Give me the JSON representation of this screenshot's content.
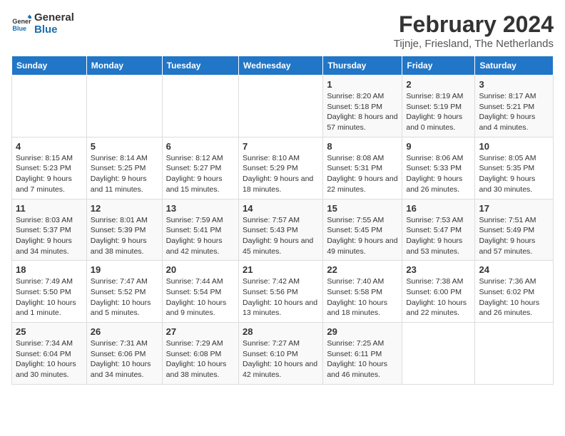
{
  "logo": {
    "text_general": "General",
    "text_blue": "Blue"
  },
  "header": {
    "title": "February 2024",
    "subtitle": "Tijnje, Friesland, The Netherlands"
  },
  "weekdays": [
    "Sunday",
    "Monday",
    "Tuesday",
    "Wednesday",
    "Thursday",
    "Friday",
    "Saturday"
  ],
  "weeks": [
    [
      {
        "day": "",
        "info": ""
      },
      {
        "day": "",
        "info": ""
      },
      {
        "day": "",
        "info": ""
      },
      {
        "day": "",
        "info": ""
      },
      {
        "day": "1",
        "info": "Sunrise: 8:20 AM\nSunset: 5:18 PM\nDaylight: 8 hours and 57 minutes."
      },
      {
        "day": "2",
        "info": "Sunrise: 8:19 AM\nSunset: 5:19 PM\nDaylight: 9 hours and 0 minutes."
      },
      {
        "day": "3",
        "info": "Sunrise: 8:17 AM\nSunset: 5:21 PM\nDaylight: 9 hours and 4 minutes."
      }
    ],
    [
      {
        "day": "4",
        "info": "Sunrise: 8:15 AM\nSunset: 5:23 PM\nDaylight: 9 hours and 7 minutes."
      },
      {
        "day": "5",
        "info": "Sunrise: 8:14 AM\nSunset: 5:25 PM\nDaylight: 9 hours and 11 minutes."
      },
      {
        "day": "6",
        "info": "Sunrise: 8:12 AM\nSunset: 5:27 PM\nDaylight: 9 hours and 15 minutes."
      },
      {
        "day": "7",
        "info": "Sunrise: 8:10 AM\nSunset: 5:29 PM\nDaylight: 9 hours and 18 minutes."
      },
      {
        "day": "8",
        "info": "Sunrise: 8:08 AM\nSunset: 5:31 PM\nDaylight: 9 hours and 22 minutes."
      },
      {
        "day": "9",
        "info": "Sunrise: 8:06 AM\nSunset: 5:33 PM\nDaylight: 9 hours and 26 minutes."
      },
      {
        "day": "10",
        "info": "Sunrise: 8:05 AM\nSunset: 5:35 PM\nDaylight: 9 hours and 30 minutes."
      }
    ],
    [
      {
        "day": "11",
        "info": "Sunrise: 8:03 AM\nSunset: 5:37 PM\nDaylight: 9 hours and 34 minutes."
      },
      {
        "day": "12",
        "info": "Sunrise: 8:01 AM\nSunset: 5:39 PM\nDaylight: 9 hours and 38 minutes."
      },
      {
        "day": "13",
        "info": "Sunrise: 7:59 AM\nSunset: 5:41 PM\nDaylight: 9 hours and 42 minutes."
      },
      {
        "day": "14",
        "info": "Sunrise: 7:57 AM\nSunset: 5:43 PM\nDaylight: 9 hours and 45 minutes."
      },
      {
        "day": "15",
        "info": "Sunrise: 7:55 AM\nSunset: 5:45 PM\nDaylight: 9 hours and 49 minutes."
      },
      {
        "day": "16",
        "info": "Sunrise: 7:53 AM\nSunset: 5:47 PM\nDaylight: 9 hours and 53 minutes."
      },
      {
        "day": "17",
        "info": "Sunrise: 7:51 AM\nSunset: 5:49 PM\nDaylight: 9 hours and 57 minutes."
      }
    ],
    [
      {
        "day": "18",
        "info": "Sunrise: 7:49 AM\nSunset: 5:50 PM\nDaylight: 10 hours and 1 minute."
      },
      {
        "day": "19",
        "info": "Sunrise: 7:47 AM\nSunset: 5:52 PM\nDaylight: 10 hours and 5 minutes."
      },
      {
        "day": "20",
        "info": "Sunrise: 7:44 AM\nSunset: 5:54 PM\nDaylight: 10 hours and 9 minutes."
      },
      {
        "day": "21",
        "info": "Sunrise: 7:42 AM\nSunset: 5:56 PM\nDaylight: 10 hours and 13 minutes."
      },
      {
        "day": "22",
        "info": "Sunrise: 7:40 AM\nSunset: 5:58 PM\nDaylight: 10 hours and 18 minutes."
      },
      {
        "day": "23",
        "info": "Sunrise: 7:38 AM\nSunset: 6:00 PM\nDaylight: 10 hours and 22 minutes."
      },
      {
        "day": "24",
        "info": "Sunrise: 7:36 AM\nSunset: 6:02 PM\nDaylight: 10 hours and 26 minutes."
      }
    ],
    [
      {
        "day": "25",
        "info": "Sunrise: 7:34 AM\nSunset: 6:04 PM\nDaylight: 10 hours and 30 minutes."
      },
      {
        "day": "26",
        "info": "Sunrise: 7:31 AM\nSunset: 6:06 PM\nDaylight: 10 hours and 34 minutes."
      },
      {
        "day": "27",
        "info": "Sunrise: 7:29 AM\nSunset: 6:08 PM\nDaylight: 10 hours and 38 minutes."
      },
      {
        "day": "28",
        "info": "Sunrise: 7:27 AM\nSunset: 6:10 PM\nDaylight: 10 hours and 42 minutes."
      },
      {
        "day": "29",
        "info": "Sunrise: 7:25 AM\nSunset: 6:11 PM\nDaylight: 10 hours and 46 minutes."
      },
      {
        "day": "",
        "info": ""
      },
      {
        "day": "",
        "info": ""
      }
    ]
  ]
}
